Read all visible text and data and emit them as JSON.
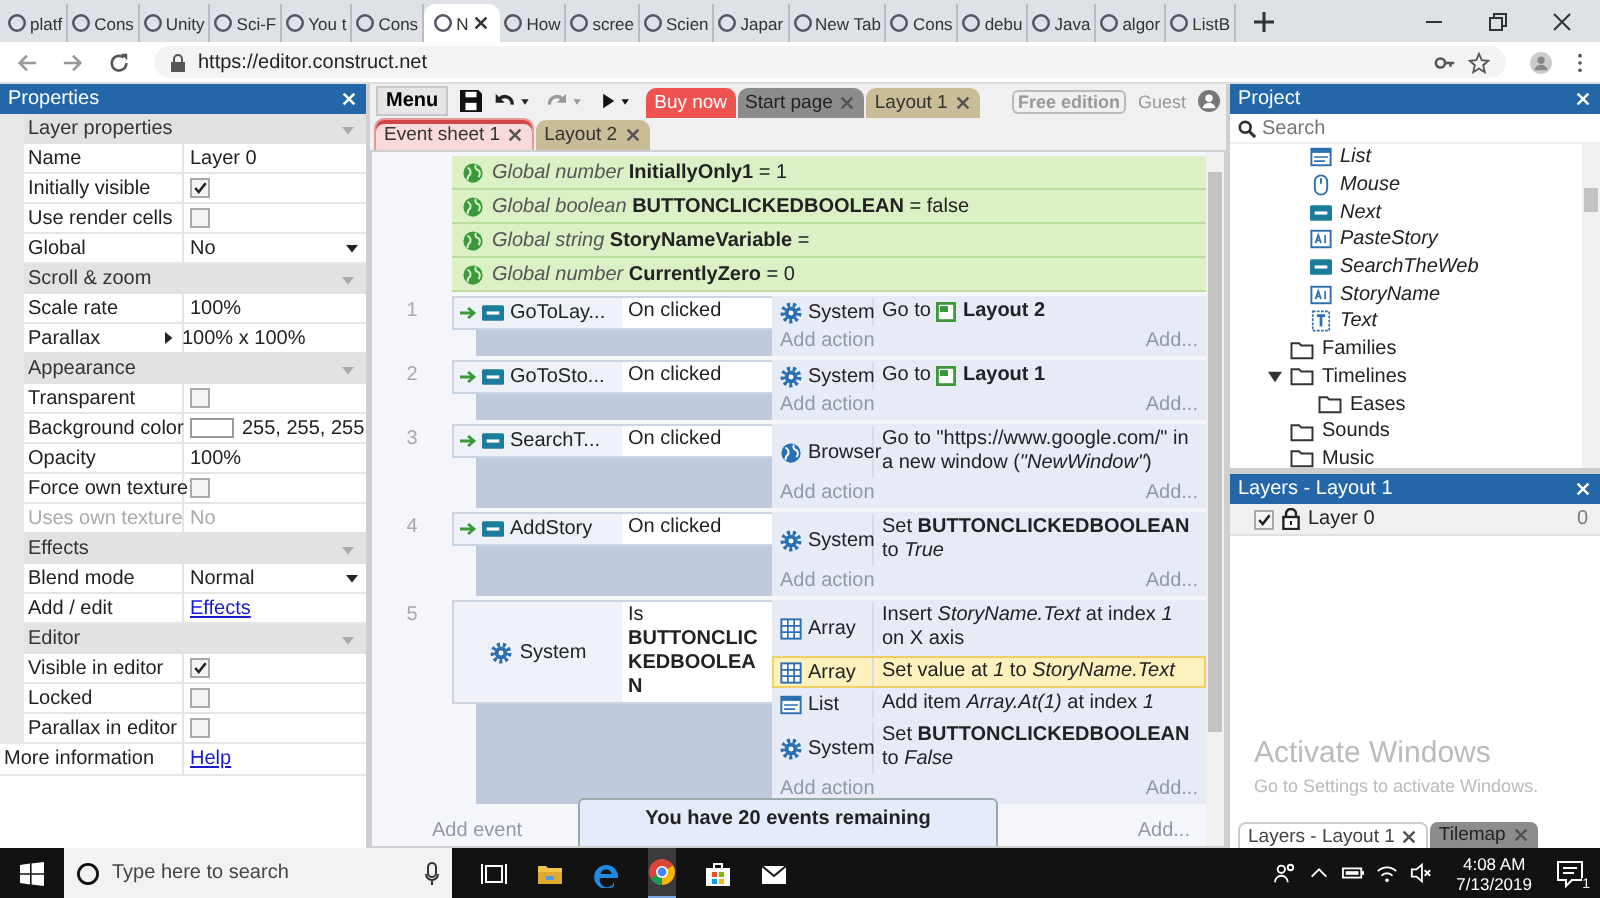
{
  "browser": {
    "tabs": [
      {
        "label": "platf",
        "selected": false
      },
      {
        "label": "Cons",
        "selected": false
      },
      {
        "label": "Unity",
        "selected": false
      },
      {
        "label": "Sci-F",
        "selected": false
      },
      {
        "label": "You t",
        "selected": false
      },
      {
        "label": "Cons",
        "selected": false
      },
      {
        "label": "N",
        "selected": true
      },
      {
        "label": "How",
        "selected": false
      },
      {
        "label": "scree",
        "selected": false
      },
      {
        "label": "Scien",
        "selected": false
      },
      {
        "label": "Japar",
        "selected": false
      },
      {
        "label": "New Tab",
        "selected": false
      },
      {
        "label": "Cons",
        "selected": false
      },
      {
        "label": "debu",
        "selected": false
      },
      {
        "label": "Java",
        "selected": false
      },
      {
        "label": "algor",
        "selected": false
      },
      {
        "label": "ListB",
        "selected": false
      }
    ],
    "url": "https://editor.construct.net"
  },
  "properties": {
    "title": "Properties",
    "sections": [
      {
        "title": "Layer properties",
        "expanded": true,
        "rows": [
          {
            "label": "Name",
            "kind": "text",
            "value": "Layer 0"
          },
          {
            "label": "Initially visible",
            "kind": "checkbox",
            "checked": true
          },
          {
            "label": "Use render cells",
            "kind": "checkbox",
            "checked": false
          },
          {
            "label": "Global",
            "kind": "dropdown",
            "value": "No"
          }
        ]
      },
      {
        "title": "Scroll & zoom",
        "expanded": true,
        "rows": [
          {
            "label": "Scale rate",
            "kind": "text",
            "value": "100%"
          },
          {
            "label": "Parallax",
            "kind": "expandable",
            "value": "100% x 100%"
          }
        ]
      },
      {
        "title": "Appearance",
        "expanded": true,
        "rows": [
          {
            "label": "Transparent",
            "kind": "checkbox",
            "checked": false
          },
          {
            "label": "Background color",
            "kind": "color",
            "color": "#ffffff",
            "value": "255, 255, 255"
          },
          {
            "label": "Opacity",
            "kind": "text",
            "value": "100%"
          },
          {
            "label": "Force own texture",
            "kind": "checkbox",
            "checked": false
          },
          {
            "label": "Uses own texture",
            "kind": "readonly",
            "value": "No"
          }
        ]
      },
      {
        "title": "Effects",
        "expanded": true,
        "rows": [
          {
            "label": "Blend mode",
            "kind": "dropdown",
            "value": "Normal"
          },
          {
            "label": "Add / edit",
            "kind": "link",
            "value": "Effects"
          }
        ]
      },
      {
        "title": "Editor",
        "expanded": true,
        "rows": [
          {
            "label": "Visible in editor",
            "kind": "checkbox",
            "checked": true
          },
          {
            "label": "Locked",
            "kind": "checkbox",
            "checked": false
          },
          {
            "label": "Parallax in editor",
            "kind": "checkbox",
            "checked": false
          }
        ]
      }
    ],
    "footer": {
      "label": "More information",
      "link": "Help"
    }
  },
  "toolbar": {
    "menu": "Menu",
    "buy": "Buy now",
    "tabs": [
      {
        "label": "Start page",
        "kind": "start"
      },
      {
        "label": "Layout 1",
        "kind": "layout"
      }
    ],
    "edition": "Free edition",
    "user": "Guest"
  },
  "sheet_tabs": [
    {
      "label": "Event sheet 1",
      "kind": "event_sheet",
      "selected": true
    },
    {
      "label": "Layout 2",
      "kind": "layout",
      "selected": false
    }
  ],
  "event_sheet": {
    "globals": [
      "*Global number* **InitiallyOnly1** = 1",
      "*Global boolean* **BUTTONCLICKEDBOOLEAN** = false",
      "*Global string* **StoryNameVariable** =",
      "*Global number* **CurrentlyZero** = 0"
    ],
    "events": [
      {
        "number": "1",
        "conditions": [
          {
            "object": "GoToLay...",
            "kind": "button",
            "trigger": true,
            "text": "On clicked"
          }
        ],
        "actions": [
          {
            "object": "System",
            "kind": "system",
            "text": "Go to",
            "target": "Layout 2",
            "selected": false
          }
        ],
        "add_action": "Add action",
        "add": "Add..."
      },
      {
        "number": "2",
        "conditions": [
          {
            "object": "GoToSto...",
            "kind": "button",
            "trigger": true,
            "text": "On clicked"
          }
        ],
        "actions": [
          {
            "object": "System",
            "kind": "system",
            "text": "Go to",
            "target": "Layout 1",
            "selected": false
          }
        ],
        "add_action": "Add action",
        "add": "Add..."
      },
      {
        "number": "3",
        "conditions": [
          {
            "object": "SearchT...",
            "kind": "button",
            "trigger": true,
            "text": "On clicked"
          }
        ],
        "actions": [
          {
            "object": "Browser",
            "kind": "browser",
            "text": "Go to \"https://www.google.com/\" in a new window (*\"NewWindow\"*)",
            "selected": false
          }
        ],
        "add_action": "Add action",
        "add": "Add..."
      },
      {
        "number": "4",
        "conditions": [
          {
            "object": "AddStory",
            "kind": "button",
            "trigger": true,
            "text": "On clicked"
          }
        ],
        "actions": [
          {
            "object": "System",
            "kind": "system",
            "text": "Set **BUTTONCLICKEDBOOLEAN** to *True*",
            "selected": false
          }
        ],
        "add_action": "Add action",
        "add": "Add..."
      },
      {
        "number": "5",
        "conditions": [
          {
            "object": "System",
            "kind": "system",
            "trigger": false,
            "text": "Is **BUTTONCLICKEDBOOLEAN**"
          }
        ],
        "actions": [
          {
            "object": "Array",
            "kind": "array",
            "text": "Insert *StoryName.Text* at index *1* on X axis",
            "selected": false
          },
          {
            "object": "Array",
            "kind": "array",
            "text": "Set value at *1* to *StoryName.Text*",
            "selected": true
          },
          {
            "object": "List",
            "kind": "list",
            "text": "Add item *Array.At(1)* at index *1*",
            "selected": false
          },
          {
            "object": "System",
            "kind": "system",
            "text": "Set **BUTTONCLICKEDBOOLEAN** to *False*",
            "selected": false
          }
        ],
        "add_action": "Add action",
        "add": "Add..."
      }
    ],
    "add_event": "Add event",
    "add_event_more": "Add...",
    "notice": "You have 20 events remaining"
  },
  "project": {
    "title": "Project",
    "search_placeholder": "Search",
    "objects": [
      {
        "label": "List",
        "kind": "list"
      },
      {
        "label": "Mouse",
        "kind": "mouse"
      },
      {
        "label": "Next",
        "kind": "button"
      },
      {
        "label": "PasteStory",
        "kind": "textbox"
      },
      {
        "label": "SearchTheWeb",
        "kind": "button"
      },
      {
        "label": "StoryName",
        "kind": "textbox"
      },
      {
        "label": "Text",
        "kind": "text"
      }
    ],
    "folders": [
      {
        "label": "Families"
      },
      {
        "label": "Timelines",
        "expanded": true,
        "children": [
          {
            "label": "Eases"
          }
        ]
      },
      {
        "label": "Sounds"
      },
      {
        "label": "Music"
      }
    ]
  },
  "layers": {
    "title": "Layers - Layout 1",
    "items": [
      {
        "label": "Layer 0",
        "visible": true,
        "count": "0"
      }
    ]
  },
  "bottom_tabs": [
    {
      "label": "Layers - Layout 1",
      "selected": true
    },
    {
      "label": "Tilemap",
      "selected": false
    }
  ],
  "activation": {
    "title": "Activate Windows",
    "subtitle": "Go to Settings to activate Windows."
  },
  "taskbar": {
    "search_placeholder": "Type here to search",
    "time": "4:08 AM",
    "date": "7/13/2019",
    "notifications": "1"
  }
}
